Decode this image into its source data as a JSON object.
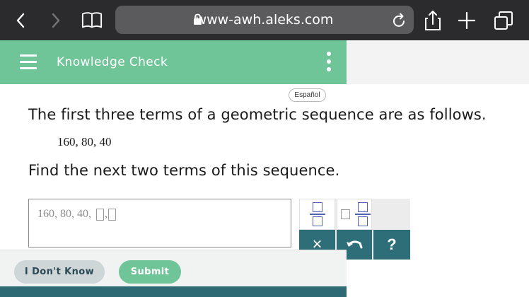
{
  "browser": {
    "url": "www-awh.aleks.com",
    "icons": [
      "back-icon",
      "forward-icon",
      "bookmarks-icon",
      "lock-icon",
      "reload-icon",
      "share-icon",
      "new-tab-icon",
      "tabs-icon"
    ]
  },
  "header": {
    "title": "Knowledge Check",
    "accent_color": "#6fc597"
  },
  "language_toggle": "Español",
  "question": {
    "statement": "The first three terms of a geometric sequence are as follows.",
    "terms": "160, 80, 40",
    "prompt": "Find the next two terms of this sequence."
  },
  "answer": {
    "prefix": "160, 80, 40,",
    "separator": ","
  },
  "palette": {
    "clear_symbol": "×",
    "help_symbol": "?"
  },
  "actions": {
    "dont_know_label": "I Don't Know",
    "submit_label": "Submit"
  }
}
